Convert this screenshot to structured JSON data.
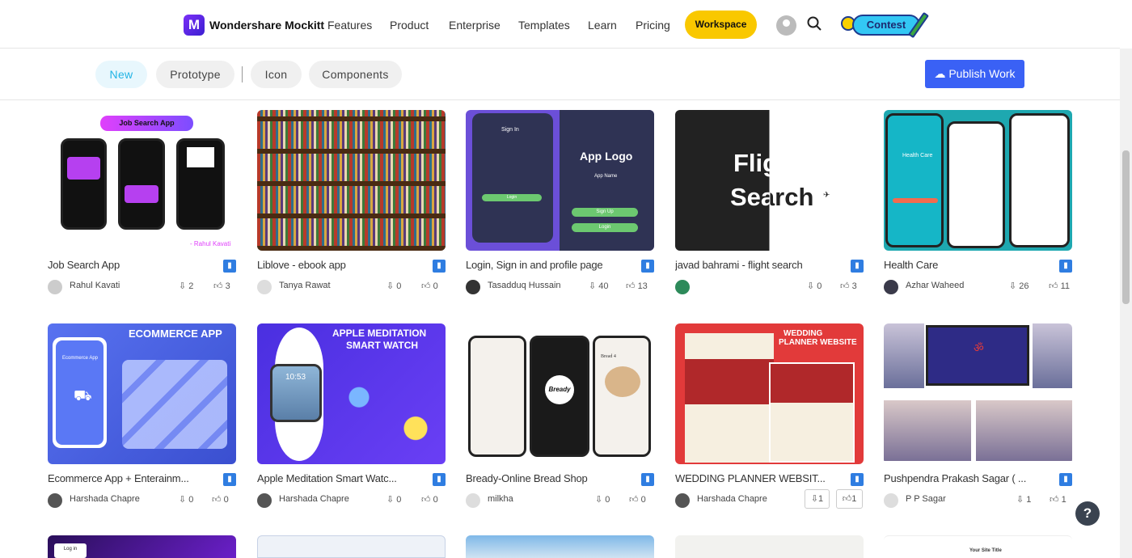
{
  "nav": {
    "logo_letter": "M",
    "brand": "Wondershare Mockitt",
    "links": [
      "Features",
      "Product",
      "Enterprise",
      "Templates",
      "Learn",
      "Pricing"
    ],
    "workspace": "Workspace",
    "contest": "Contest"
  },
  "filters": {
    "chips": [
      "New",
      "Prototype",
      "Icon",
      "Components"
    ],
    "publish": "Publish Work"
  },
  "cards": [
    {
      "title": "Job Search App",
      "author": "Rahul Kavati",
      "downloads": "2",
      "likes": "3",
      "overlay": "Job Search App",
      "credit": "- Rahul Kavati"
    },
    {
      "title": "Liblove - ebook app",
      "author": "Tanya Rawat",
      "downloads": "0",
      "likes": "0"
    },
    {
      "title": "Login, Sign in and profile page",
      "author": "Tasadduq Hussain",
      "downloads": "40",
      "likes": "13",
      "overlay": "App Logo",
      "sub": "App Name",
      "sign": "Sign In",
      "b1": "Login",
      "b2": "Sign Up"
    },
    {
      "title": "javad bahrami - flight search",
      "author": "",
      "downloads": "0",
      "likes": "3",
      "overlay1": "Fligth",
      "overlay2": "Search"
    },
    {
      "title": "Health Care",
      "author": "Azhar Waheed",
      "downloads": "26",
      "likes": "11",
      "overlay": "Health Care"
    },
    {
      "title": "Ecommerce App + Enterainm...",
      "author": "Harshada Chapre",
      "downloads": "0",
      "likes": "0",
      "overlay": "ECOMMERCE APP",
      "sub": "Ecommerce App"
    },
    {
      "title": "Apple Meditation Smart Watc...",
      "author": "Harshada Chapre",
      "downloads": "0",
      "likes": "0",
      "overlay1": "APPLE MEDITATION",
      "overlay2": "SMART WATCH",
      "time": "10:53"
    },
    {
      "title": "Bready-Online Bread Shop",
      "author": "milkha",
      "downloads": "0",
      "likes": "0",
      "overlay": "Bready",
      "sub": "Bread 4"
    },
    {
      "title": "WEDDING PLANNER WEBSIT...",
      "author": "Harshada Chapre",
      "downloads": "1",
      "likes": "1",
      "overlay1": "WEDDING",
      "overlay2": "PLANNER WEBSITE"
    },
    {
      "title": "Pushpendra Prakash Sagar ( ...",
      "author": "P P Sagar",
      "downloads": "1",
      "likes": "1",
      "overlay": "ॐ"
    }
  ],
  "bottom": {
    "login": "Log in",
    "site": "Your Site Title"
  },
  "help": "?"
}
